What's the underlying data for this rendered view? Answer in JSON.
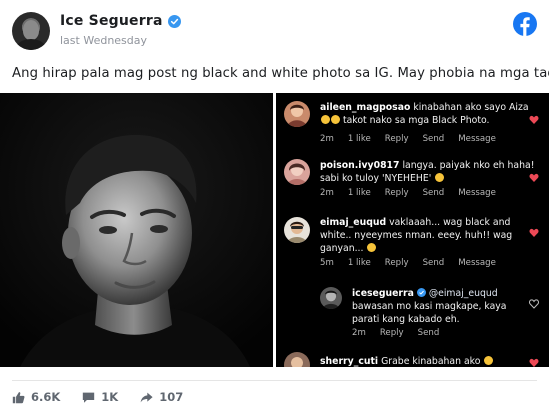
{
  "post": {
    "author": "Ice Seguerra",
    "time": "last Wednesday",
    "text": "Ang hirap pala mag post ng black and white photo sa IG. May phobia na mga tao."
  },
  "comments": [
    {
      "user": "aileen_magposao",
      "lines": [
        "kinabahan ako sayo Aiza",
        "takot nako sa mga Black Photo."
      ],
      "meta": [
        "2m",
        "1 like",
        "Reply",
        "Send",
        "Message"
      ],
      "liked": true
    },
    {
      "user": "poison.ivy0817",
      "lines": [
        "langya. paiyak nko eh haha!",
        "sabi ko tuloy 'NYEHEHE'"
      ],
      "meta": [
        "2m",
        "1 like",
        "Reply",
        "Send",
        "Message"
      ],
      "liked": true
    },
    {
      "user": "eimaj_euqud",
      "lines": [
        "vaklaaah... wag black and",
        "white.. nyeeymes nman. eeey. huh!! wag",
        "ganyan..."
      ],
      "meta": [
        "5m",
        "1 like",
        "Reply",
        "Send",
        "Message"
      ],
      "liked": true
    },
    {
      "user": "iceseguerra",
      "mention": "@eimaj_euqud",
      "lines": [
        "bawasan mo kasi magkape, kaya",
        "parati kang kabado eh."
      ],
      "meta": [
        "2m",
        "Reply",
        "Send"
      ],
      "liked": false
    },
    {
      "user": "sherry_cuti",
      "lines": [
        "Grabe kinabahan ako"
      ],
      "meta": [],
      "liked": true
    }
  ],
  "reactions": {
    "likes": "6.6K",
    "comments": "1K",
    "shares": "107"
  },
  "colors": {
    "facebook_blue": "#1877f2",
    "heart_red": "#ed4956",
    "verified_blue": "#3897f0"
  },
  "icons": [
    "verified-badge-icon",
    "facebook-logo-icon",
    "heart-icon",
    "like-thumb-icon",
    "comment-bubble-icon",
    "share-arrow-icon"
  ]
}
